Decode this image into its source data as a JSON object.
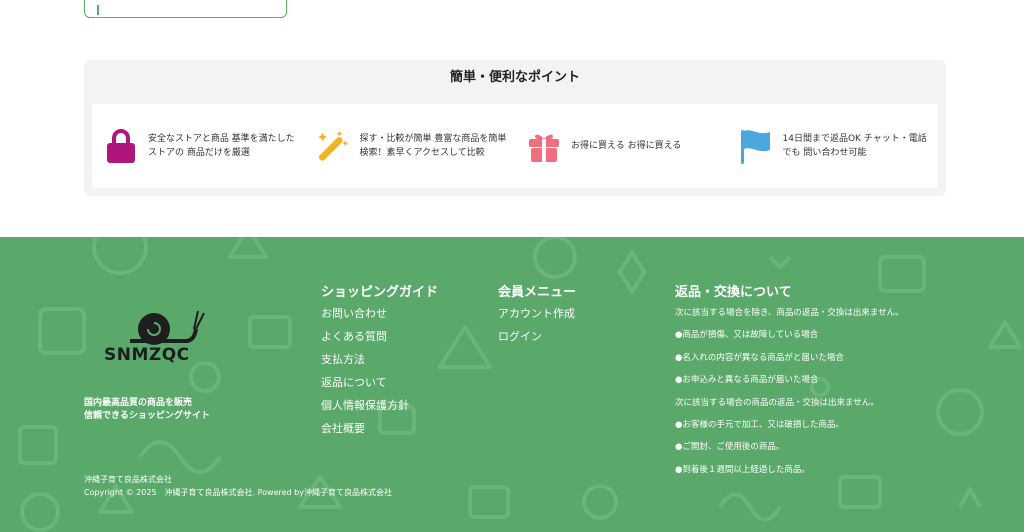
{
  "points": {
    "title": "簡単・便利なポイント",
    "items": [
      {
        "icon": "lock-icon",
        "text": "安全なストアと商品 基準を満たしたストアの 商品だけを厳選",
        "color": "#b0157c"
      },
      {
        "icon": "magic-wand-icon",
        "text": "探す・比較が簡単 豊富な商品を簡単検索！素早くアクセスして比較",
        "color": "#f3b31c"
      },
      {
        "icon": "gift-icon",
        "text": "お得に買える お得に買える",
        "color": "#ee6f7f"
      },
      {
        "icon": "flag-icon",
        "text": "14日間まで返品OK チャット・電話でも 問い合わせ可能",
        "color": "#4aa8de"
      }
    ]
  },
  "footer": {
    "logo_text": "SNMZQC",
    "tagline": [
      "国内最高品質の商品を販売",
      "信頼できるショッピングサイト"
    ],
    "company_name": "沖縄子育て良品株式会社",
    "copyright": "Copyright © 2025　沖縄子育て良品株式会社. Powered by沖縄子育て良品株式会社",
    "guide": {
      "title": "ショッピングガイド",
      "links": [
        "お問い合わせ",
        "よくある質問",
        "支払方法",
        "返品について",
        "個人情報保護方針",
        "会社概要"
      ]
    },
    "member": {
      "title": "会員メニュー",
      "links": [
        "アカウント作成",
        "ログイン"
      ]
    },
    "returns": {
      "title": "返品・交換について",
      "lines": [
        "次に該当する場合を除き、商品の返品・交換は出来ません。",
        "●商品が損傷、又は故障している場合",
        "●名入れの内容が異なる商品がと届いた場合",
        "●お申込みと異なる商品が届いた場合",
        "次に該当する場合の商品の返品・交換は出来ません。",
        "●お客様の手元で加工、又は破損した商品。",
        "●ご開封、ご使用後の商品。",
        "●到着後１週間以上経過した商品。"
      ]
    },
    "bg_color": "#5aa86a"
  }
}
